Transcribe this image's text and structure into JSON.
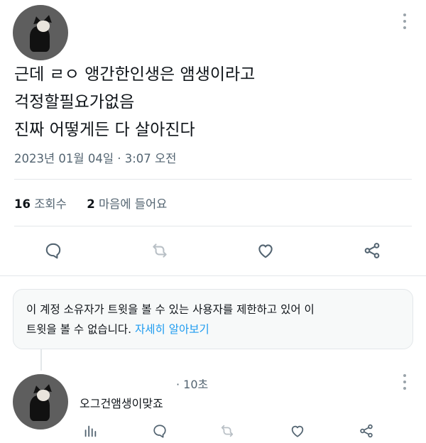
{
  "tweet": {
    "lines": [
      "근데 ㄹㅇ 앵간한인생은 앰생이라고",
      "걱정할필요가없음",
      "진짜 어떻게든 다 살아진다"
    ],
    "timestamp": "2023년 01월 04일 · 3:07 오전",
    "views_count": "16",
    "views_label": "조회수",
    "likes_count": "2",
    "likes_label": "마음에 들어요",
    "actions": [
      "reply-icon",
      "retweet-icon",
      "like-icon",
      "share-icon"
    ]
  },
  "notice": {
    "text": "이 계정 소유자가 트윗을 볼 수 있는 사용자를 제한하고 있어 이 트윗을 볼 수 없습니다.",
    "line1": "이 계정 소유자가 트윗을 볼 수 있는 사용자를 제한하고 있어 이",
    "line2": "트윗을 볼 수 없습니다.",
    "link": "자세히 알아보기"
  },
  "reply": {
    "time": "· 10초",
    "text": "오그건앰생이맞죠",
    "actions": [
      "analytics-icon",
      "reply-icon",
      "retweet-icon",
      "like-icon",
      "share-icon"
    ]
  },
  "colors": {
    "text": "#0f1419",
    "muted": "#536471",
    "icon": "#536471",
    "border": "#e3e7ea",
    "link": "#1d9bf0",
    "notice_bg": "#f7f9f9"
  }
}
